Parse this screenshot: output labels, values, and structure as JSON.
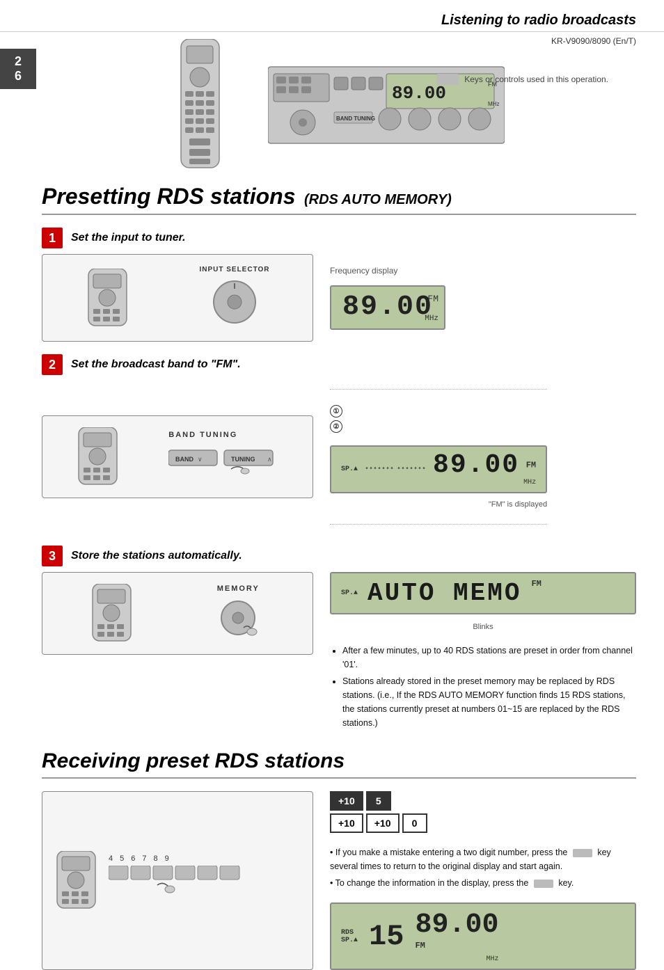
{
  "header": {
    "title": "Listening to radio broadcasts",
    "model": "KR-V9090/8090 (En/T)"
  },
  "page_number": "2 6",
  "section1": {
    "title": "Presetting RDS stations",
    "subtitle": "(RDS AUTO MEMORY)",
    "steps": [
      {
        "number": "1",
        "description": "Set the input to tuner.",
        "diagram_label": "INPUT SELECTOR",
        "right_label": "Frequency display",
        "freq": "89.00",
        "freq_band": "FM",
        "freq_unit": "MHz"
      },
      {
        "number": "2",
        "description": "Set the broadcast band to \"FM\".",
        "diagram_label": "BAND TUNING",
        "circle1": "①",
        "circle2": "②",
        "freq": "89.00",
        "freq_band": "FM",
        "freq_unit": "MHz",
        "fm_displayed": "\"FM\" is displayed"
      },
      {
        "number": "3",
        "description": "Store the stations automatically.",
        "diagram_label": "MEMORY",
        "auto_memo": "AUTO MEMO",
        "blinks": "Blinks"
      }
    ],
    "bullets": [
      "After a few minutes, up to 40 RDS stations are preset in order from channel '01'.",
      "Stations already stored in the preset memory may be replaced by RDS stations. (i.e., If the RDS AUTO MEMORY function finds 15 RDS stations, the stations currently preset at numbers 01~15 are replaced by the RDS stations.)"
    ]
  },
  "section2": {
    "title": "Receiving preset RDS stations",
    "number_row_top": "+10  5",
    "number_row_bot": "+10  +10  0",
    "preset_nums": [
      "4",
      "5",
      "6",
      "7",
      "8",
      "9"
    ],
    "bullet1": "If you make a mistake entering a two digit number, press the",
    "bullet1_end": "key several times to return to the original display and start again.",
    "bullet2": "To change the information in the display, press the",
    "bullet2_end": "key.",
    "channel_display": "15",
    "freq_display": "89.00",
    "freq_band": "FM",
    "freq_unit": "MHz"
  },
  "keys_note": "Keys or controls used in this operation."
}
